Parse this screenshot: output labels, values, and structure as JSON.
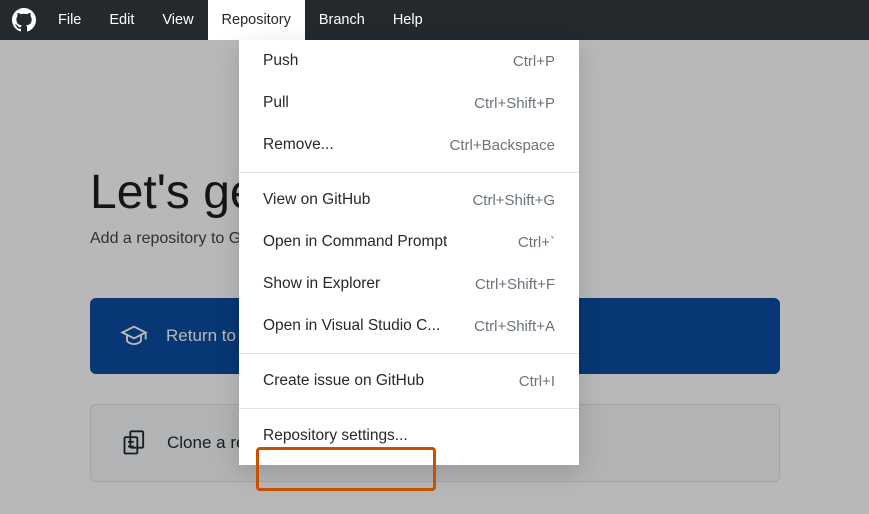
{
  "menubar": {
    "items": [
      {
        "label": "File"
      },
      {
        "label": "Edit"
      },
      {
        "label": "View"
      },
      {
        "label": "Repository"
      },
      {
        "label": "Branch"
      },
      {
        "label": "Help"
      }
    ]
  },
  "headline": "Let's get started!",
  "subhead": "Add a repository to GitHub Desktop to start collaborating",
  "primary_btn": "Return to GitHub Desktop tutorial",
  "secondary_btn": "Clone a repository from the Internet...",
  "dropdown": {
    "groups": [
      [
        {
          "label": "Push",
          "shortcut": "Ctrl+P"
        },
        {
          "label": "Pull",
          "shortcut": "Ctrl+Shift+P"
        },
        {
          "label": "Remove...",
          "shortcut": "Ctrl+Backspace"
        }
      ],
      [
        {
          "label": "View on GitHub",
          "shortcut": "Ctrl+Shift+G"
        },
        {
          "label": "Open in Command Prompt",
          "shortcut": "Ctrl+`"
        },
        {
          "label": "Show in Explorer",
          "shortcut": "Ctrl+Shift+F"
        },
        {
          "label": "Open in Visual Studio C...",
          "shortcut": "Ctrl+Shift+A"
        }
      ],
      [
        {
          "label": "Create issue on GitHub",
          "shortcut": "Ctrl+I"
        }
      ],
      [
        {
          "label": "Repository settings...",
          "shortcut": ""
        }
      ]
    ]
  }
}
